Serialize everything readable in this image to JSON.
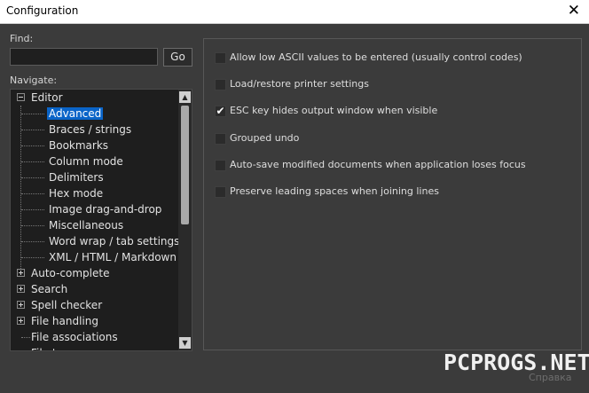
{
  "window": {
    "title": "Configuration",
    "close_glyph": "✕"
  },
  "find": {
    "label": "Find:",
    "value": "",
    "placeholder": "",
    "go_label": "Go"
  },
  "navigate": {
    "label": "Navigate:"
  },
  "tree": {
    "editor": "Editor",
    "editor_children": [
      "Advanced",
      "Braces / strings",
      "Bookmarks",
      "Column mode",
      "Delimiters",
      "Hex mode",
      "Image drag-and-drop",
      "Miscellaneous",
      "Word wrap / tab settings",
      "XML / HTML / Markdown"
    ],
    "selected": "Advanced",
    "groups": [
      "Auto-complete",
      "Search",
      "Spell checker",
      "File handling"
    ],
    "leaves": [
      "File associations",
      "File types"
    ]
  },
  "options": [
    {
      "label": "Allow low ASCII values to be entered (usually control codes)",
      "checked": false
    },
    {
      "label": "Load/restore printer settings",
      "checked": false
    },
    {
      "label": "ESC key hides output window when visible",
      "checked": true
    },
    {
      "label": "Grouped undo",
      "checked": false
    },
    {
      "label": "Auto-save modified documents when application loses focus",
      "checked": false
    },
    {
      "label": "Preserve leading spaces when joining lines",
      "checked": false
    }
  ],
  "checkmark_glyph": "✔",
  "watermark": "PCPROGS.NET",
  "footer_text": "Справка",
  "colors": {
    "selection": "#0a64c8",
    "tree_bg": "#1e1e1e",
    "panel_bg": "#3b3b3b"
  }
}
